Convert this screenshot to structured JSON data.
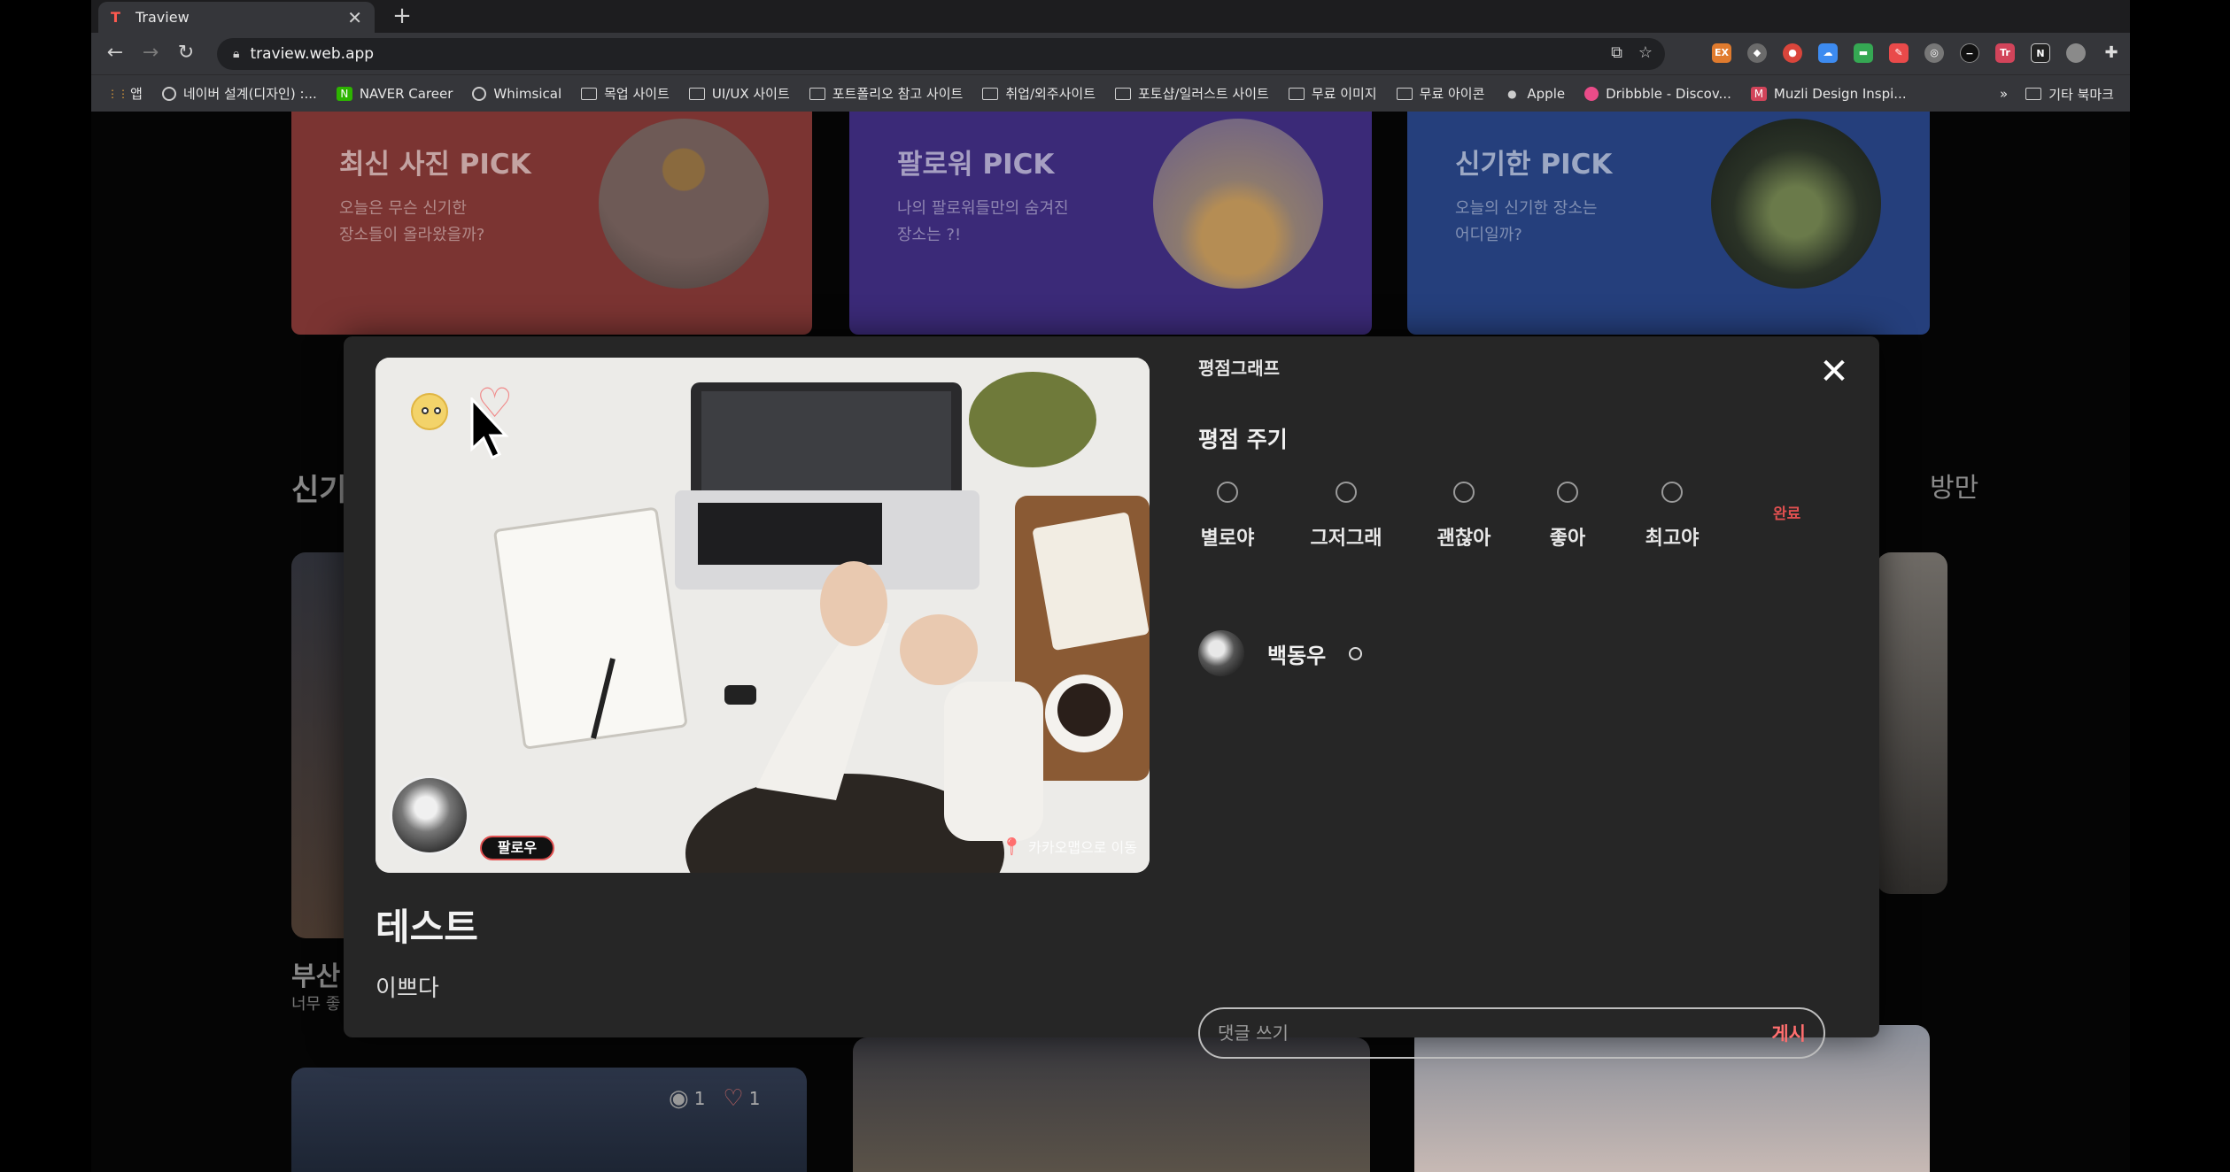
{
  "browser": {
    "tab_title": "Traview",
    "url": "traview.web.app",
    "bookmarks": [
      {
        "label": "앱",
        "icon": "apps-grid-icon"
      },
      {
        "label": "네이버 설계(디자인) :...",
        "icon": "globe-icon"
      },
      {
        "label": "NAVER Career",
        "icon": "naver-icon"
      },
      {
        "label": "Whimsical",
        "icon": "globe-icon"
      },
      {
        "label": "목업 사이트",
        "icon": "folder-icon"
      },
      {
        "label": "UI/UX 사이트",
        "icon": "folder-icon"
      },
      {
        "label": "포트폴리오 참고 사이트",
        "icon": "folder-icon"
      },
      {
        "label": "취업/외주사이트",
        "icon": "folder-icon"
      },
      {
        "label": "포토샵/일러스트 사이트",
        "icon": "folder-icon"
      },
      {
        "label": "무료 이미지",
        "icon": "folder-icon"
      },
      {
        "label": "무료 아이콘",
        "icon": "folder-icon"
      },
      {
        "label": "Apple",
        "icon": "apple-icon"
      },
      {
        "label": "Dribbble - Discov...",
        "icon": "dribbble-icon"
      },
      {
        "label": "Muzli Design Inspi...",
        "icon": "muzli-icon"
      }
    ],
    "bookmarks_more": "»",
    "other_bookmarks": "기타 북마크"
  },
  "banners": [
    {
      "title": "최신 사진 PICK",
      "subtitle": "오늘은 무슨 신기한\n장소들이 올라왔을까?"
    },
    {
      "title": "팔로워 PICK",
      "subtitle": "나의 팔로워들만의 숨겨진\n장소는 ?!"
    },
    {
      "title": "신기한 PICK",
      "subtitle": "오늘의 신기한 장소는\n어디일까?"
    }
  ],
  "background": {
    "section_left": "신기",
    "section_right": "방만",
    "card_title": "부산",
    "card_sub": "너무 좋",
    "card_stats": {
      "eye": "1",
      "heart": "1"
    }
  },
  "modal": {
    "graph_label": "평점그래프",
    "rate_heading": "평점 주기",
    "rating_options": [
      "별로야",
      "그저그래",
      "괜찮아",
      "좋아",
      "최고야"
    ],
    "done_label": "완료",
    "follow_label": "팔로우",
    "kakao_label": "카카오맵으로 이동",
    "post_title": "테스트",
    "post_description": "이쁘다",
    "user_name": "백동우",
    "comment_placeholder": "댓글 쓰기",
    "post_button": "게시"
  },
  "colors": {
    "accent_red": "#e05050",
    "modal_bg": "#262626"
  }
}
